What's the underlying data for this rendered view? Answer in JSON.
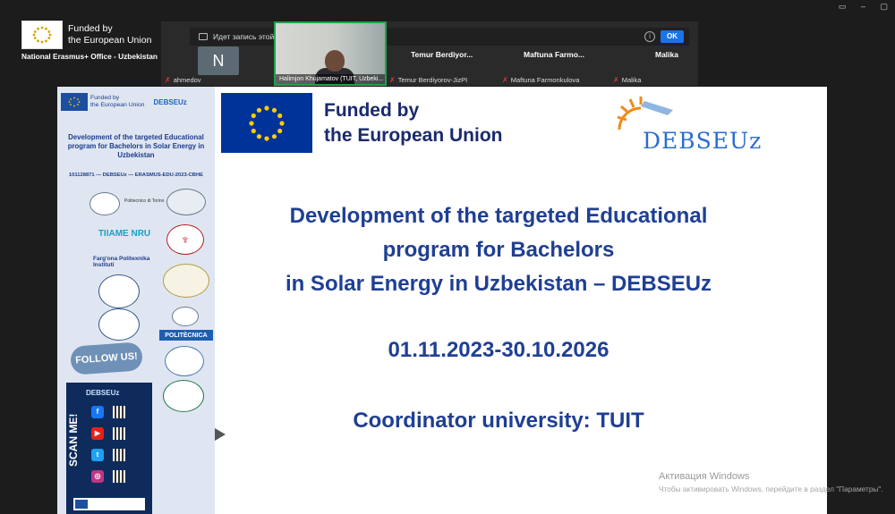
{
  "badge": {
    "funded_line1": "Funded by",
    "funded_line2": "the European Union",
    "office": "National Erasmus+ Office - Uzbekistan"
  },
  "conference": {
    "record_notice": "Идет запись этой конференции",
    "ok_label": "OK",
    "tiles": [
      {
        "initial": "N",
        "label": "ahmedov"
      },
      {
        "name": "",
        "label": "Halimjon Khujamatov (TUIT, Uzbeki..."
      },
      {
        "name": "Temur Berdiyor...",
        "label": "Temur Berdiyorov-JizPI"
      },
      {
        "name": "Maftuna Farmo...",
        "label": "Maftuna Farmonkulova"
      },
      {
        "name": "Malika",
        "label": "Malika"
      }
    ]
  },
  "slide": {
    "side": {
      "mini_funded": "Funded by\nthe European Union",
      "mini_debseuz": "DEBSEUz",
      "title": "Development of the targeted Educational program for Bachelors in Solar Energy in Uzbekistan",
      "code": "101128871 — DEBSEUz — ERASMUS-EDU-2023-CBHE",
      "partners": [
        "Politecnico di Torino",
        "TIIAME NRU",
        "Farg'ona Politexnika Instituti",
        "Universidade de Évora",
        "POLITÈCNICA"
      ],
      "follow_us": "FOLLOW US!",
      "scan_me": "SCAN ME!",
      "scan_debs": "DEBSEUz"
    },
    "funded_line1": "Funded by",
    "funded_line2": "the European Union",
    "logo_word": "DEBSEUz",
    "headline_1": "Development of the targeted Educational",
    "headline_2": "program for Bachelors",
    "headline_3": "in Solar Energy in Uzbekistan – DEBSEUz",
    "dates": "01.11.2023-30.10.2026",
    "coordinator": "Coordinator university: TUIT"
  },
  "windows": {
    "activate": "Активация Windows",
    "activate_sub": "Чтобы активировать Windows, перейдите в раздел \"Параметры\"."
  },
  "colors": {
    "eu_blue": "#003399",
    "eu_star": "#ffcc00",
    "title_blue": "#1f3f93"
  }
}
